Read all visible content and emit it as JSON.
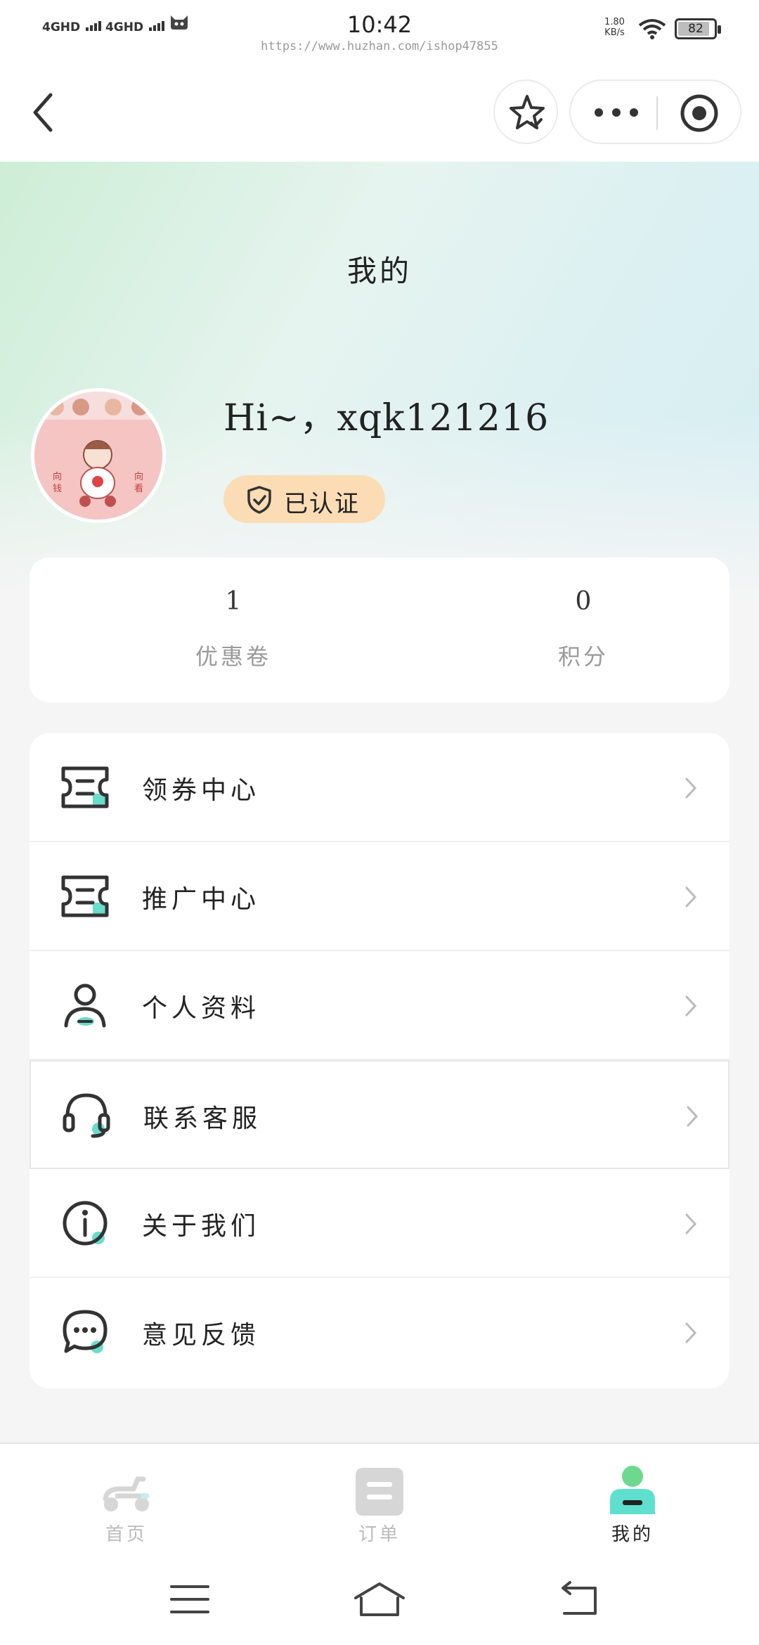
{
  "status_bar": {
    "network1": "4GHD",
    "network2": "4GHD",
    "time": "10:42",
    "url": "https://www.huzhan.com/ishop47855",
    "speed_value": "1.80",
    "speed_unit": "KB/s",
    "battery": "82"
  },
  "header": {
    "back_icon": "chevron-left-icon",
    "favorite_icon": "star-icon",
    "more_icon": "more-dots-icon",
    "close_icon": "target-icon"
  },
  "profile": {
    "page_title": "我的",
    "greeting": "Hi~，xqk121216",
    "verified_label": "已认证",
    "avatar_alt": "avatar"
  },
  "stats": {
    "coupons": {
      "value": "1",
      "label": "优惠卷"
    },
    "points": {
      "value": "0",
      "label": "积分"
    }
  },
  "menu": {
    "items": [
      {
        "label": "领券中心",
        "icon": "coupon-icon"
      },
      {
        "label": "推广中心",
        "icon": "promotion-icon"
      },
      {
        "label": "个人资料",
        "icon": "user-icon"
      },
      {
        "label": "联系客服",
        "icon": "headset-icon"
      },
      {
        "label": "关于我们",
        "icon": "info-icon"
      },
      {
        "label": "意见反馈",
        "icon": "chat-icon"
      }
    ]
  },
  "tabbar": {
    "home": "首页",
    "orders": "订单",
    "mine": "我的",
    "active": "mine"
  },
  "colors": {
    "accent": "#4fd6c3",
    "verified_bg": "#fcdcb4",
    "active_tab": "#5fe0cf"
  }
}
